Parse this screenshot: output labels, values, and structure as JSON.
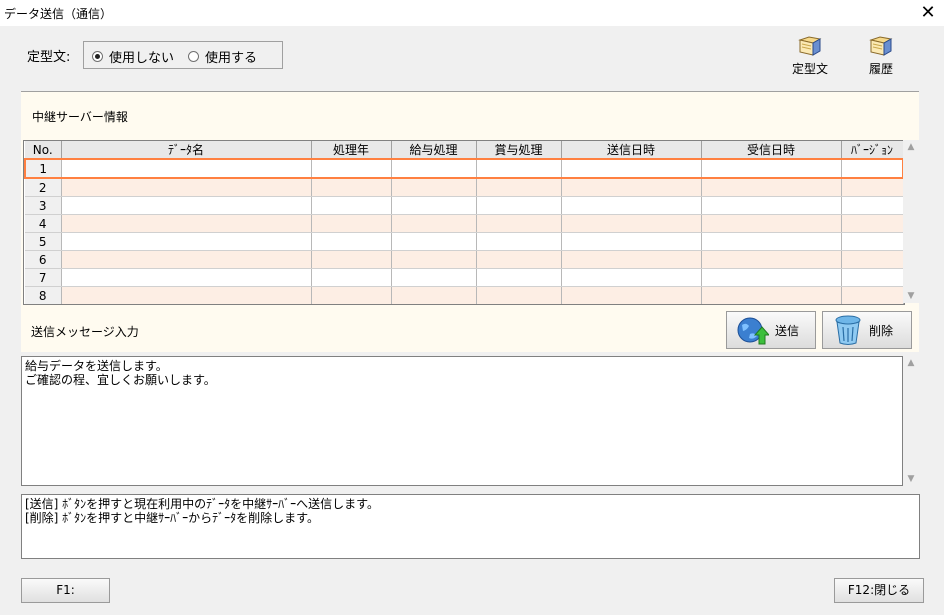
{
  "window": {
    "title": "データ送信（通信）"
  },
  "template": {
    "label": "定型文:",
    "options": [
      {
        "label": "使用しない",
        "selected": true
      },
      {
        "label": "使用する",
        "selected": false
      }
    ]
  },
  "toolbar": {
    "template_label": "定型文",
    "history_label": "履歴"
  },
  "relay": {
    "section_label": "中継サーバー情報",
    "columns": [
      "No.",
      "ﾃﾞｰﾀ名",
      "処理年",
      "給与処理",
      "賞与処理",
      "送信日時",
      "受信日時",
      "ﾊﾞｰｼﾞｮﾝ"
    ],
    "rows": [
      "1",
      "2",
      "3",
      "4",
      "5",
      "6",
      "7",
      "8"
    ]
  },
  "message": {
    "section_label": "送信メッセージ入力",
    "send_label": "送信",
    "delete_label": "削除",
    "text": "給与データを送信します。\nご確認の程、宜しくお願いします。"
  },
  "help": {
    "text": "[送信] ﾎﾞﾀﾝを押すと現在利用中のﾃﾞｰﾀを中継ｻｰﾊﾞｰへ送信します。\n[削除] ﾎﾞﾀﾝを押すと中継ｻｰﾊﾞｰからﾃﾞｰﾀを削除します。"
  },
  "footer": {
    "f1_label": "F1:",
    "f12_label": "F12:閉じる"
  },
  "colors": {
    "selected_row_border": "#ff8040",
    "alt_row": "#fdeee4",
    "panel_bg": "#fffbf0"
  }
}
